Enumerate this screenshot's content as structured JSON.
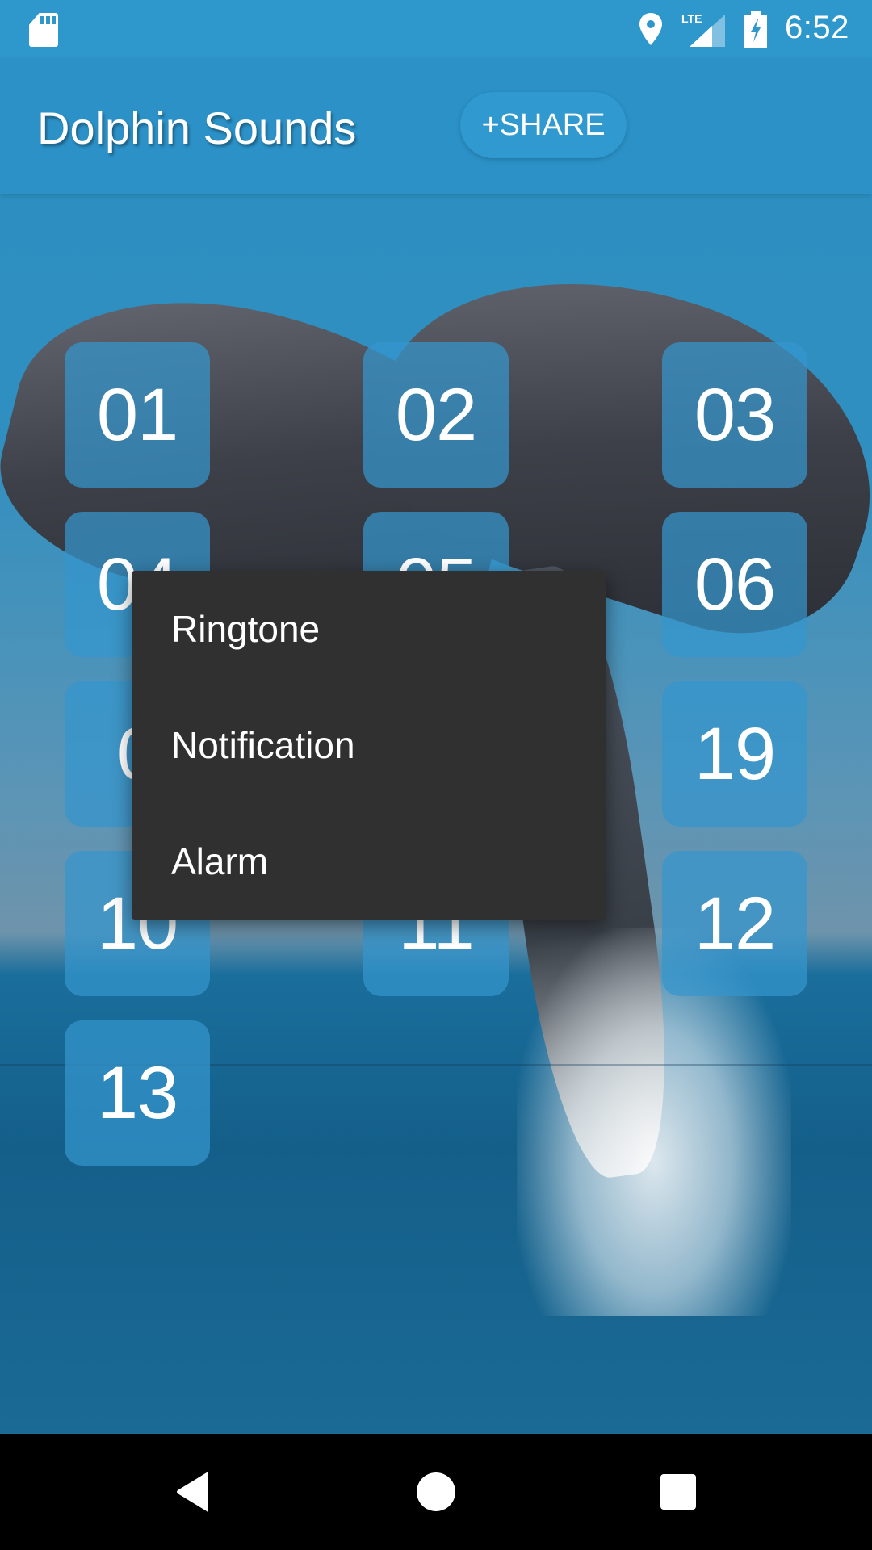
{
  "status_bar": {
    "time": "6:52",
    "icons": [
      "sd-card-icon",
      "location-icon",
      "lte-signal-icon",
      "battery-charging-icon"
    ],
    "network_label": "LTE"
  },
  "app_bar": {
    "title": "Dolphin Sounds",
    "share_label": "+SHARE"
  },
  "colors": {
    "accent": "#2e97cb",
    "tile": "#3496cd",
    "menu_bg": "#303030",
    "nav_bg": "#000000"
  },
  "grid": {
    "tiles": [
      {
        "label": "01"
      },
      {
        "label": "02"
      },
      {
        "label": "03"
      },
      {
        "label": "04"
      },
      {
        "label": "05"
      },
      {
        "label": "06"
      },
      {
        "label": "0"
      },
      {
        "label": ""
      },
      {
        "label": "19"
      },
      {
        "label": "10"
      },
      {
        "label": "11"
      },
      {
        "label": "12"
      },
      {
        "label": "13"
      }
    ]
  },
  "popup_menu": {
    "items": [
      {
        "label": "Ringtone"
      },
      {
        "label": "Notification"
      },
      {
        "label": "Alarm"
      }
    ]
  },
  "nav_bar": {
    "buttons": [
      "back",
      "home",
      "recents"
    ]
  }
}
